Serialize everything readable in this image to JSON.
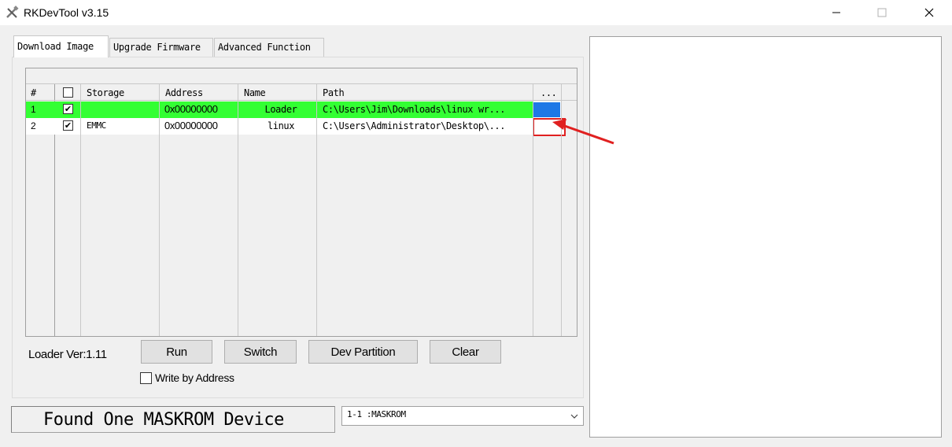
{
  "window": {
    "title": "RKDevTool v3.15",
    "icon": "tool-icon",
    "controls": [
      "minimize-icon",
      "maximize-icon",
      "close-icon"
    ]
  },
  "tabs": [
    {
      "label": "Download Image",
      "active": true
    },
    {
      "label": "Upgrade Firmware",
      "active": false
    },
    {
      "label": "Advanced Function",
      "active": false
    }
  ],
  "grid": {
    "columns": [
      "#",
      "",
      "Storage",
      "Address",
      "Name",
      "Path",
      "..."
    ],
    "rows": [
      {
        "num": "1",
        "checked": true,
        "storage": "",
        "address": "0x00000000",
        "name": "Loader",
        "path": "C:\\Users\\Jim\\Downloads\\linux wr...",
        "highlight": "#33ff33"
      },
      {
        "num": "2",
        "checked": true,
        "storage": "EMMC",
        "address": "0x00000000",
        "name": "linux",
        "path": "C:\\Users\\Administrator\\Desktop\\...",
        "highlight": "#ffffff"
      }
    ]
  },
  "loader_version": "Loader Ver:1.11",
  "buttons": {
    "run": "Run",
    "switch": "Switch",
    "dev_partition": "Dev Partition",
    "clear": "Clear"
  },
  "write_by_address": {
    "label": "Write by Address",
    "checked": false
  },
  "status": "Found One MASKROM Device",
  "device_select": {
    "value": "1-1 :MASKROM"
  },
  "colors": {
    "row_loader": "#33ff33",
    "browse_selected": "#1e78e6",
    "annotation": "#e02020"
  }
}
